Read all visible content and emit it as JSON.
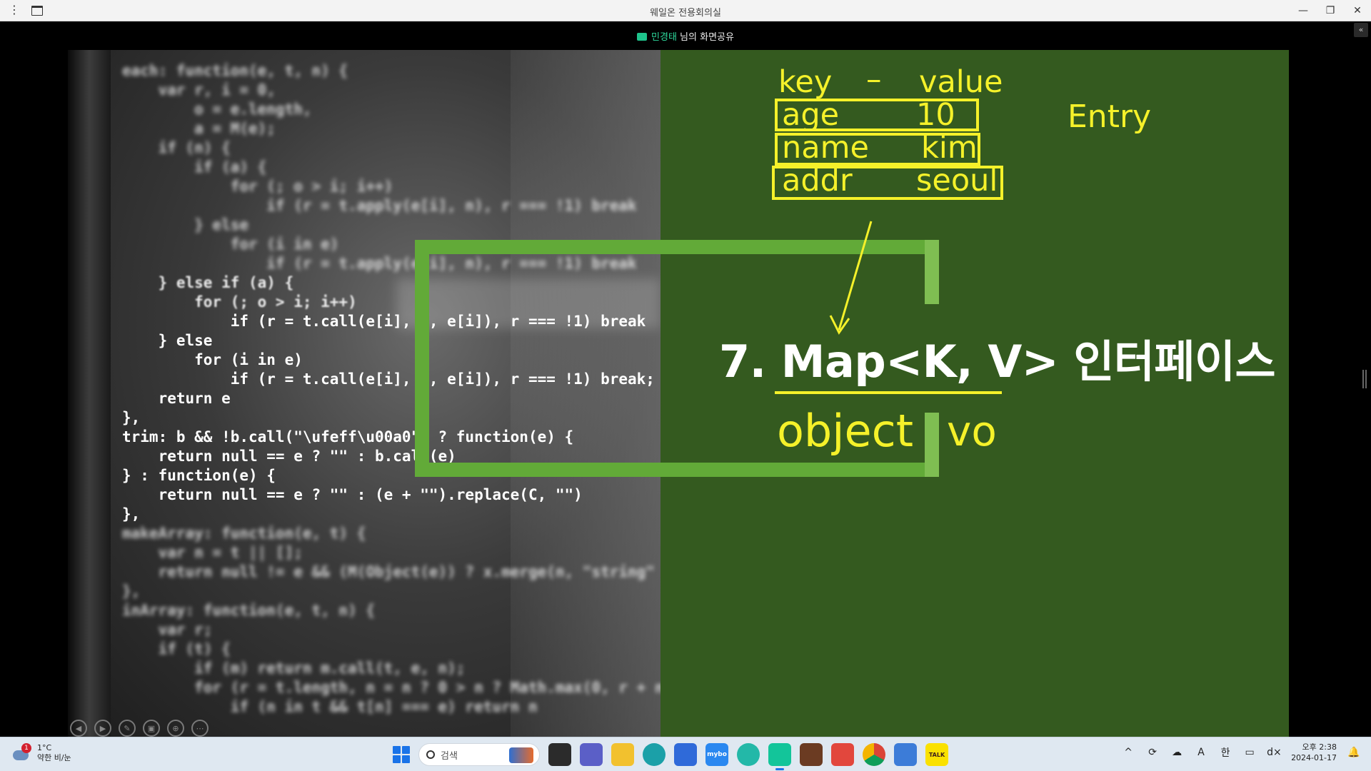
{
  "window": {
    "title": "웨일온 전용회의실",
    "controls": [
      "minimize",
      "restore",
      "close"
    ]
  },
  "share_banner": {
    "presenter": "민경태",
    "suffix": " 님의 화면공유"
  },
  "slide": {
    "code_lines": [
      "each: function(e, t, n) {",
      "    var r, i = 0,",
      "        o = e.length,",
      "        a = M(e);",
      "    if (n) {",
      "        if (a) {",
      "            for (; o > i; i++)",
      "                if (r = t.apply(e[i], n), r === !1) break",
      "        } else",
      "            for (i in e)",
      "                if (r = t.apply(e[i], n), r === !1) break",
      "    } else if (a) {",
      "        for (; o > i; i++)",
      "            if (r = t.call(e[i], i, e[i]), r === !1) break",
      "    } else",
      "        for (i in e)",
      "            if (r = t.call(e[i], i, e[i]), r === !1) break;",
      "    return e",
      "},",
      "trim: b && !b.call(\"\\ufeff\\u00a0\") ? function(e) {",
      "    return null == e ? \"\" : b.call(e)",
      "} : function(e) {",
      "    return null == e ? \"\" : (e + \"\").replace(C, \"\")",
      "},",
      "makeArray: function(e, t) {",
      "    var n = t || [];",
      "    return null != e && (M(Object(e)) ? x.merge(n, \"string\" ",
      "},",
      "inArray: function(e, t, n) {",
      "    var r;",
      "    if (t) {",
      "        if (m) return m.call(t, e, n);",
      "        for (r = t.length, n = n ? 0 > n ? Math.max(0, r + n",
      "            if (n in t && t[n] === e) return n"
    ],
    "kv_header": {
      "key": "key",
      "dash": "–",
      "value": "value"
    },
    "kv_rows": [
      {
        "key": "age",
        "value": "10"
      },
      {
        "key": "name",
        "value": "kim"
      },
      {
        "key": "addr",
        "value": "seoul"
      }
    ],
    "entry_label": "Entry",
    "heading": "7. Map<K, V> 인터페이스",
    "object_label": "object",
    "vo_label": "vo",
    "colors": {
      "annotation": "#f5f12a",
      "panel": "#345a1f",
      "frame": "#62aa38"
    },
    "player_controls": [
      "prev-icon",
      "next-icon",
      "pen-icon",
      "slides-icon",
      "zoom-icon",
      "more-icon"
    ]
  },
  "taskbar": {
    "weather": {
      "temp": "1°C",
      "desc": "약한 비/눈",
      "badge": "1"
    },
    "search_placeholder": "검색",
    "apps": [
      {
        "name": "task-view",
        "label": ""
      },
      {
        "name": "meet",
        "label": ""
      },
      {
        "name": "file-explorer",
        "label": ""
      },
      {
        "name": "edge",
        "label": ""
      },
      {
        "name": "store",
        "label": ""
      },
      {
        "name": "mybox",
        "label": "mybo"
      },
      {
        "name": "whale",
        "label": ""
      },
      {
        "name": "whale-on",
        "label": ""
      },
      {
        "name": "game",
        "label": ""
      },
      {
        "name": "rec",
        "label": ""
      },
      {
        "name": "chrome",
        "label": ""
      },
      {
        "name": "notepad",
        "label": ""
      },
      {
        "name": "kakaotalk",
        "label": "TALK"
      }
    ],
    "tray": {
      "ime_a": "A",
      "ime_ko": "한",
      "sound": "d×"
    },
    "clock": {
      "time": "오후 2:38",
      "date": "2024-01-17"
    }
  }
}
